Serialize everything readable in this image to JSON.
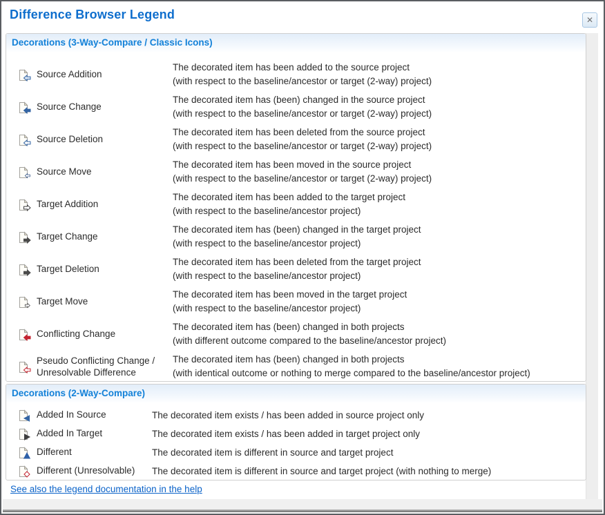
{
  "dialog": {
    "title": "Difference Browser Legend",
    "close_glyph": "✕"
  },
  "colors": {
    "title_blue": "#0e6ecd",
    "heading_blue": "#1381d8",
    "link_blue": "#0b63c9",
    "source_blue": "#3465a4",
    "target_gray": "#474747",
    "conflict_red": "#c4232f"
  },
  "sections": [
    {
      "heading": "Decorations (3-Way-Compare / Classic Icons)",
      "rows": [
        {
          "icon": {
            "name": "source-addition-icon",
            "glyph": "arrow-left",
            "variant": "tint",
            "color": "#3465a4"
          },
          "label": "Source Addition",
          "desc": [
            "The decorated item has been added to the source project",
            "(with respect to the baseline/ancestor or target (2-way) project)"
          ]
        },
        {
          "icon": {
            "name": "source-change-icon",
            "glyph": "arrow-left",
            "variant": "solid",
            "color": "#3465a4"
          },
          "label": "Source Change",
          "desc": [
            "The decorated item has (been) changed in the source project",
            "(with respect to the baseline/ancestor or target (2-way) project)"
          ]
        },
        {
          "icon": {
            "name": "source-deletion-icon",
            "glyph": "arrow-left",
            "variant": "hollow",
            "color": "#3465a4"
          },
          "label": "Source Deletion",
          "desc": [
            "The decorated item has been deleted from the source project",
            "(with respect to the baseline/ancestor or target (2-way) project)"
          ]
        },
        {
          "icon": {
            "name": "source-move-icon",
            "glyph": "arrow-left-sm",
            "variant": "hollow",
            "color": "#26477c"
          },
          "label": "Source Move",
          "desc": [
            "The decorated item has been moved in the source project",
            "(with respect to the baseline/ancestor or target (2-way) project)"
          ]
        },
        {
          "icon": {
            "name": "target-addition-icon",
            "glyph": "arrow-right",
            "variant": "hollow",
            "color": "#3f3f3f"
          },
          "label": "Target Addition",
          "desc": [
            "The decorated item has been added to the target project",
            "(with respect to the baseline/ancestor project)"
          ]
        },
        {
          "icon": {
            "name": "target-change-icon",
            "glyph": "arrow-right",
            "variant": "solid",
            "color": "#4a4a4a"
          },
          "label": "Target Change",
          "desc": [
            "The decorated item has (been) changed in the target project",
            "(with respect to the baseline/ancestor project)"
          ]
        },
        {
          "icon": {
            "name": "target-deletion-icon",
            "glyph": "arrow-right",
            "variant": "solid",
            "color": "#4a4a4a"
          },
          "label": "Target Deletion",
          "desc": [
            "The decorated item has been deleted from the target project",
            "(with respect to the baseline/ancestor project)"
          ]
        },
        {
          "icon": {
            "name": "target-move-icon",
            "glyph": "arrow-right-sm",
            "variant": "hollow",
            "color": "#3f3f3f"
          },
          "label": "Target Move",
          "desc": [
            "The decorated item has been moved in the target project",
            "(with respect to the baseline/ancestor project)"
          ]
        },
        {
          "icon": {
            "name": "conflicting-change-icon",
            "glyph": "arrow-left",
            "variant": "solid",
            "color": "#c4232f"
          },
          "label": "Conflicting Change",
          "desc": [
            "The decorated item has (been) changed in both projects",
            "(with different outcome compared to the baseline/ancestor project)"
          ]
        },
        {
          "icon": {
            "name": "pseudo-conflicting-change-icon",
            "glyph": "arrow-left",
            "variant": "hollow",
            "color": "#c4232f"
          },
          "label": "Pseudo Conflicting Change / Unresolvable Difference",
          "desc": [
            "The decorated item has (been) changed in both projects",
            "(with identical outcome or nothing to merge compared to the baseline/ancestor project)"
          ]
        }
      ]
    },
    {
      "heading": "Decorations (2-Way-Compare)",
      "rows": [
        {
          "icon": {
            "name": "added-in-source-icon",
            "glyph": "tri-left",
            "variant": "solid",
            "color": "#3465a4"
          },
          "label": "Added In Source",
          "desc": [
            "The decorated item exists / has been added in source project only"
          ]
        },
        {
          "icon": {
            "name": "added-in-target-icon",
            "glyph": "tri-right",
            "variant": "solid",
            "color": "#3f3f3f"
          },
          "label": "Added In Target",
          "desc": [
            "The decorated item exists / has been added in target project only"
          ]
        },
        {
          "icon": {
            "name": "different-icon",
            "glyph": "tri-up",
            "variant": "solid",
            "color": "#2d5fa6"
          },
          "label": "Different",
          "desc": [
            "The decorated item is different in source and target project"
          ]
        },
        {
          "icon": {
            "name": "different-unresolvable-icon",
            "glyph": "diamond",
            "variant": "hollow",
            "color": "#c4232f"
          },
          "label": "Different (Unresolvable)",
          "desc": [
            "The decorated item is different in source and target project (with nothing to merge)"
          ]
        }
      ]
    }
  ],
  "footer": {
    "link": "See also the legend documentation in the help"
  }
}
